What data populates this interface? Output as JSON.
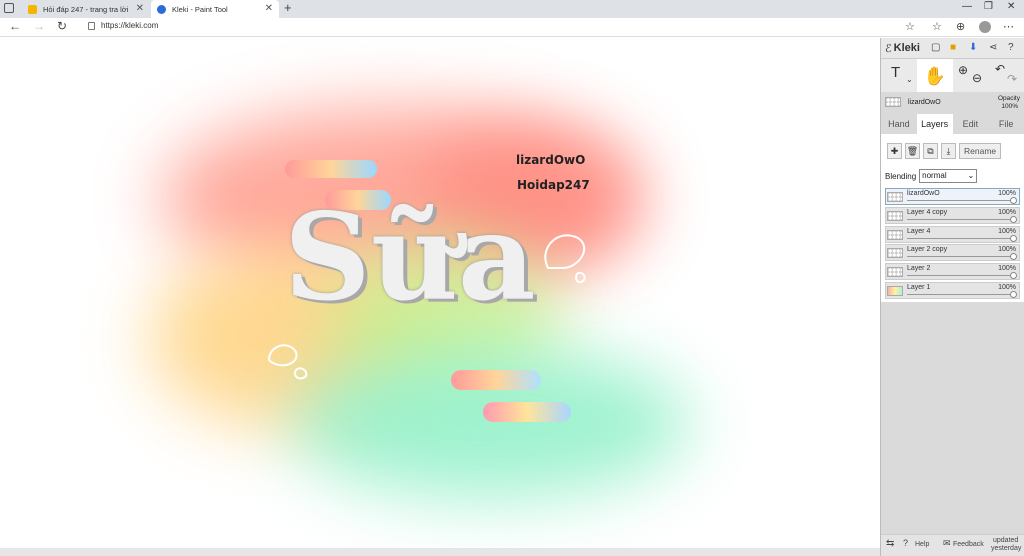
{
  "browser": {
    "tabs": [
      {
        "title": "Hỏi đáp 247 - trang tra lời",
        "favicon_color": "#f5b400"
      },
      {
        "title": "Kleki - Paint Tool",
        "favicon_color": "#2d6bd8"
      }
    ],
    "new_tab": "+",
    "url": "https://kleki.com"
  },
  "canvas": {
    "text1": "lizardOwO",
    "text2": "Hoidap247",
    "title_art": "Sữa"
  },
  "panel": {
    "logo": "Kleki",
    "current_layer": "lizardOwO",
    "opacity_label": "Opacity",
    "opacity_value": "100%",
    "tabs": [
      "Hand",
      "Layers",
      "Edit",
      "File"
    ],
    "rename_label": "Rename",
    "blending_label": "Blending",
    "blending_value": "normal",
    "layers": [
      {
        "name": "lizardOwO",
        "opacity": "100%"
      },
      {
        "name": "Layer 4 copy",
        "opacity": "100%"
      },
      {
        "name": "Layer 4",
        "opacity": "100%"
      },
      {
        "name": "Layer 2 copy",
        "opacity": "100%"
      },
      {
        "name": "Layer 2",
        "opacity": "100%"
      },
      {
        "name": "Layer 1",
        "opacity": "100%"
      }
    ],
    "footer": {
      "help": "Help",
      "feedback": "Feedback",
      "updated1": "updated",
      "updated2": "yesterday"
    }
  },
  "colors": {
    "accent": "#2d6bd8",
    "panel_bg": "#dadada"
  }
}
